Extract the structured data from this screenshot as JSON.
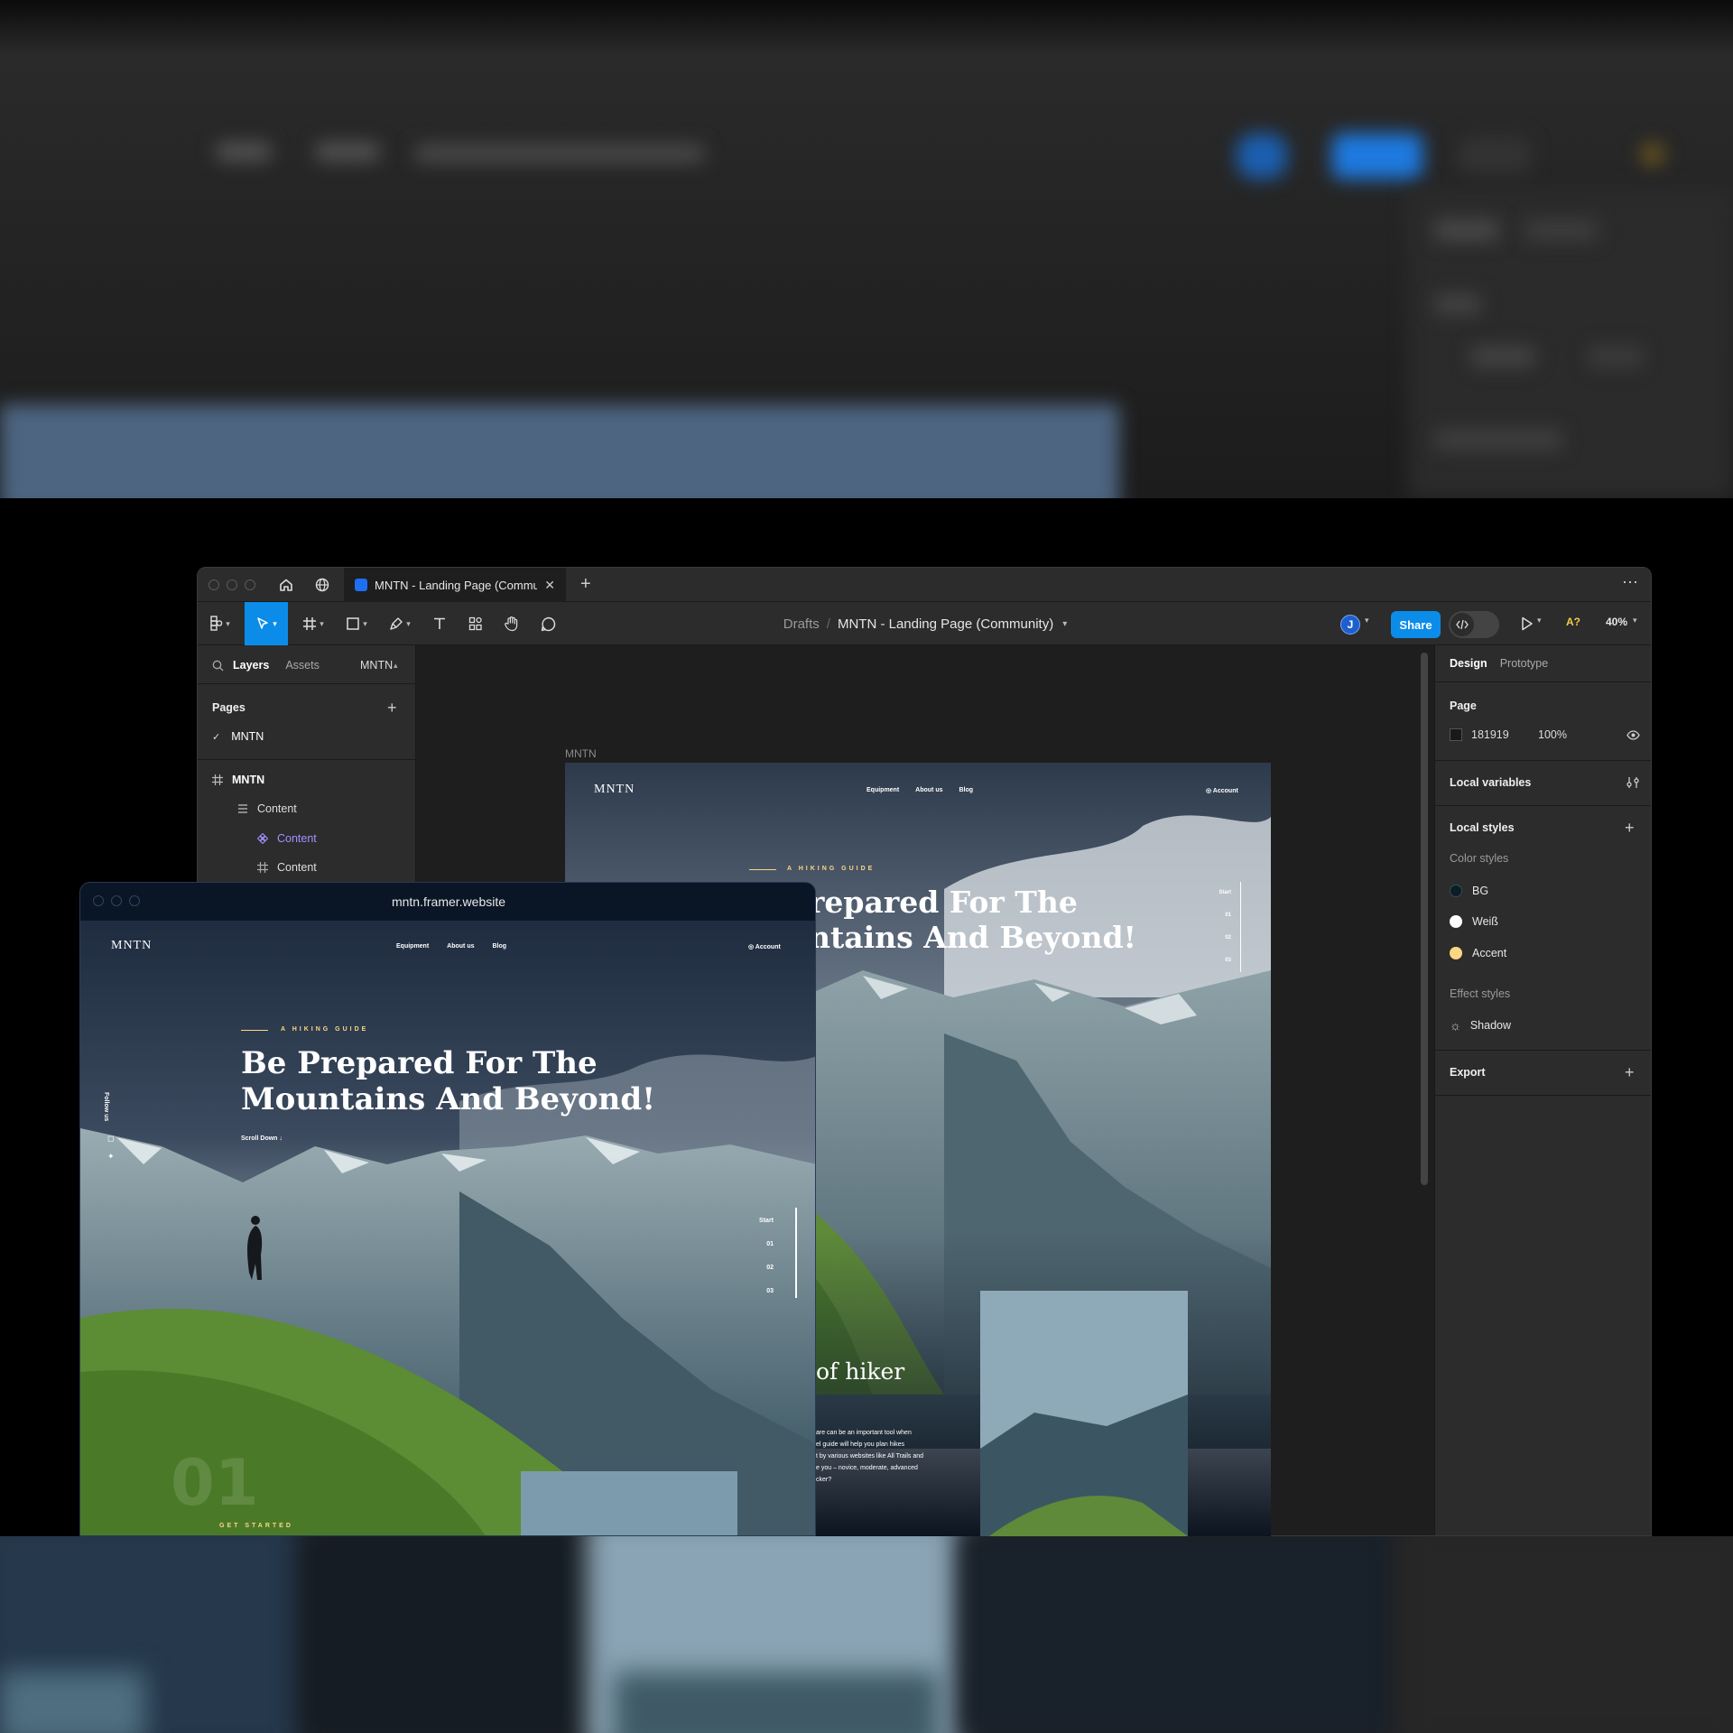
{
  "app": {
    "tab_title": "MNTN - Landing Page (Community)",
    "breadcrumb_root": "Drafts",
    "breadcrumb_sep": "/",
    "file_name": "MNTN - Landing Page (Community)",
    "avatar_initial": "J",
    "share_label": "Share",
    "font_warning": "A?",
    "zoom": "40%"
  },
  "left_panel": {
    "tabs": [
      "Layers",
      "Assets"
    ],
    "page_selector": "MNTN",
    "pages_heading": "Pages",
    "pages": [
      "MNTN"
    ],
    "layers": [
      {
        "label": "MNTN",
        "kind": "frame"
      },
      {
        "label": "Content",
        "kind": "stack"
      },
      {
        "label": "Content",
        "kind": "component"
      },
      {
        "label": "Content",
        "kind": "frame"
      }
    ]
  },
  "right_panel": {
    "tabs": [
      "Design",
      "Prototype"
    ],
    "page_heading": "Page",
    "page_color": "181919",
    "page_opacity": "100%",
    "local_variables": "Local variables",
    "local_styles": "Local styles",
    "color_styles_heading": "Color styles",
    "color_styles": [
      {
        "name": "BG",
        "color": "#0b1d26"
      },
      {
        "name": "Weiß",
        "color": "#ffffff"
      },
      {
        "name": "Accent",
        "color": "#fbd784"
      }
    ],
    "effect_styles_heading": "Effect styles",
    "effect_styles": [
      "Shadow"
    ],
    "export_heading": "Export"
  },
  "canvas": {
    "frame_label": "MNTN",
    "site": {
      "logo": "MNTN",
      "nav": [
        "Equipment",
        "About us",
        "Blog"
      ],
      "account": "Account",
      "tagline": "A HIKING GUIDE",
      "hero_line1": "repared For The",
      "hero_line2": "ntains And Beyond!",
      "slider": [
        "Start",
        "01",
        "02",
        "03"
      ],
      "section_title": "of hiker",
      "section_body": [
        "are can be an important tool when",
        "el guide will help you plan hikes",
        "t by various websites like All Trails and",
        "e you – novice, moderate, advanced",
        "cker?"
      ]
    }
  },
  "browser": {
    "url": "mntn.framer.website",
    "logo": "MNTN",
    "nav": [
      "Equipment",
      "About us",
      "Blog"
    ],
    "account": "Account",
    "tagline": "A HIKING GUIDE",
    "hero_line1": "Be Prepared For The",
    "hero_line2": "Mountains And Beyond!",
    "scroll_down": "Scroll Down",
    "follow_us": "Follow us",
    "slider": [
      "Start",
      "01",
      "02",
      "03"
    ],
    "get_started": "GET STARTED",
    "big_number": "01"
  },
  "colors": {
    "accent": "#fbd784",
    "share_blue": "#0c8ce9",
    "tool_active": "#0c8ce9",
    "component_purple": "#a48fff"
  }
}
